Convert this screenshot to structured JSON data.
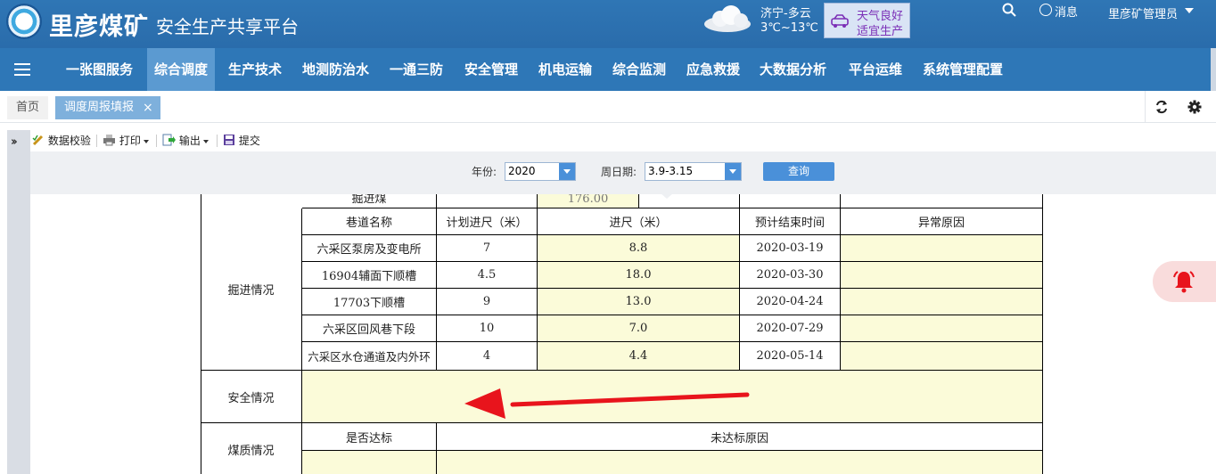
{
  "header": {
    "brand": "里彦煤矿",
    "subtitle": "安全生产共享平台",
    "weather": {
      "location": "济宁-多云",
      "temperature": "3℃~13℃",
      "advice_line1": "天气良好",
      "advice_line2": "适宜生产"
    },
    "message_label": "消息",
    "user_label": "里彦矿管理员"
  },
  "nav": {
    "items": [
      "一张图服务",
      "综合调度",
      "生产技术",
      "地测防治水",
      "一通三防",
      "安全管理",
      "机电运输",
      "综合监测",
      "应急救援",
      "大数据分析",
      "平台运维",
      "系统管理配置"
    ],
    "active": "综合调度"
  },
  "tabs": {
    "home": "首页",
    "active": "调度周报填报",
    "close": "×"
  },
  "toolbar": {
    "validate": "数据校验",
    "print": "打印",
    "export": "输出",
    "submit": "提交"
  },
  "query": {
    "year_label": "年份:",
    "year_value": "2020",
    "week_label": "周日期:",
    "week_value": "3.9-3.15",
    "button": "查询"
  },
  "table": {
    "partial_row": {
      "label": "掘进煤",
      "value": "176.00"
    },
    "excavation": {
      "section_label": "掘进情况",
      "headers": [
        "巷道名称",
        "计划进尺（米）",
        "进尺（米）",
        "预计结束时间",
        "异常原因"
      ],
      "rows": [
        {
          "name": "六采区泵房及变电所",
          "plan": "7",
          "actual": "8.8",
          "end": "2020-03-19",
          "reason": ""
        },
        {
          "name": "16904辅面下顺槽",
          "plan": "4.5",
          "actual": "18.0",
          "end": "2020-03-30",
          "reason": ""
        },
        {
          "name": "17703下顺槽",
          "plan": "9",
          "actual": "13.0",
          "end": "2020-04-24",
          "reason": ""
        },
        {
          "name": "六采区回风巷下段",
          "plan": "10",
          "actual": "7.0",
          "end": "2020-07-29",
          "reason": ""
        },
        {
          "name": "六采区水仓通道及内外环",
          "plan": "4",
          "actual": "4.4",
          "end": "2020-05-14",
          "reason": ""
        }
      ]
    },
    "safety": {
      "label": "安全情况",
      "value": ""
    },
    "coal_quality": {
      "label": "煤质情况",
      "headers": [
        "是否达标",
        "未达标原因"
      ]
    }
  },
  "colors": {
    "header_blue": "#2f76b5",
    "nav_active": "#5b9ad1",
    "cell_yellow": "#fbfbd9",
    "arrow_red": "#e8141c",
    "button_blue": "#4a90d9"
  }
}
